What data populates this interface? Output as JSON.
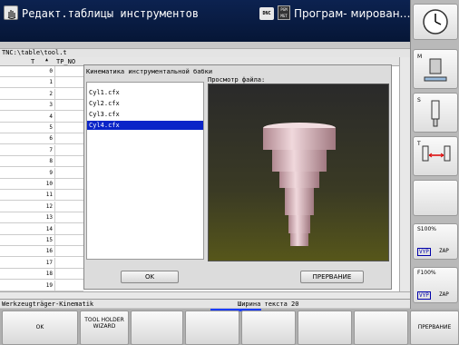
{
  "header": {
    "title": "Редакт.таблицы инструментов",
    "dnc_badge": "DNC",
    "pgm_badge": "PGM MGT",
    "mode_right": "Програм- мирован…"
  },
  "path": "TNC:\\table\\tool.t",
  "table": {
    "col_t": "T",
    "col_tp": "TP_NO",
    "rows": [
      "0",
      "1",
      "2",
      "3",
      "4",
      "5",
      "6",
      "7",
      "8",
      "9",
      "10",
      "11",
      "12",
      "13",
      "14",
      "15",
      "16",
      "17",
      "18",
      "19"
    ]
  },
  "dialog": {
    "title": "Кинематика инструментальной бабки",
    "files": [
      "Cyl1.cfx",
      "Cyl2.cfx",
      "Cyl3.cfx",
      "Cyl4.cfx"
    ],
    "selected_index": 3,
    "preview_label": "Просмотр файла:",
    "ok_label": "OK",
    "cancel_label": "ПРЕРВАНИЕ"
  },
  "status": {
    "left": "Werkzeugträger-Kinematik",
    "right": "Ширина текста 20"
  },
  "right_softkeys": {
    "m_label": "M",
    "s_label": "S",
    "t_label": "T",
    "s_override": "S100%",
    "f_override": "F100%",
    "vyp1": "VYP",
    "zap1": "ZAP",
    "vyp2": "VYP",
    "zap2": "ZAP"
  },
  "bottom_softkeys": {
    "ok": "OK",
    "wizard": "TOOL HOLDER WIZARD",
    "cancel": "ПРЕРВАНИЕ"
  },
  "colors": {
    "header_bg": "#0c2250",
    "selection": "#0a24c8",
    "accent_orange": "#f0a000"
  }
}
